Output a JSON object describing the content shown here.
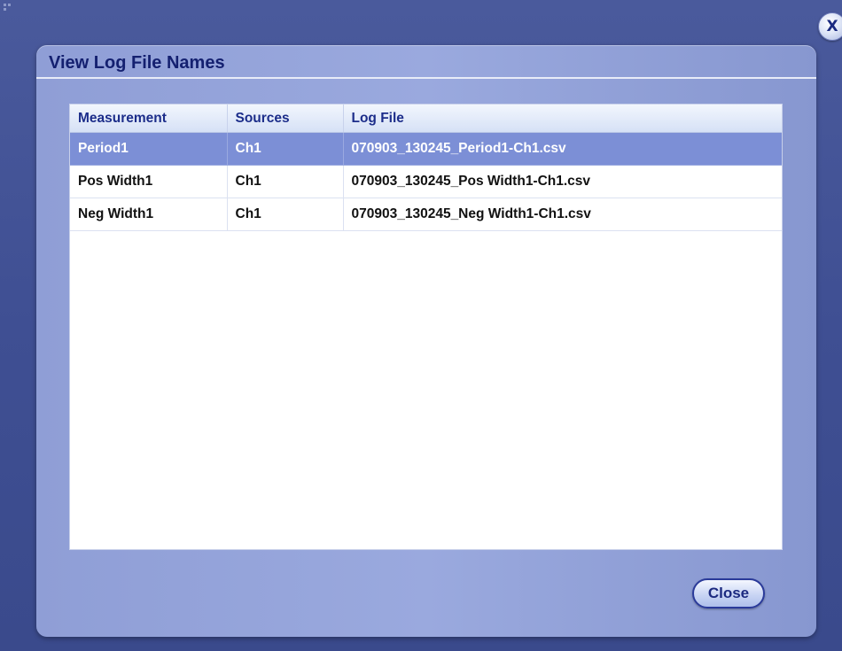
{
  "window": {
    "close_glyph": "X"
  },
  "dialog": {
    "title": "View Log File Names",
    "close_button_label": "Close"
  },
  "table": {
    "headers": [
      "Measurement",
      "Sources",
      "Log File"
    ],
    "rows": [
      [
        "Period1",
        "Ch1",
        "070903_130245_Period1-Ch1.csv"
      ],
      [
        "Pos Width1",
        "Ch1",
        "070903_130245_Pos Width1-Ch1.csv"
      ],
      [
        "Neg Width1",
        "Ch1",
        "070903_130245_Neg Width1-Ch1.csv"
      ]
    ],
    "selected_row": 0
  },
  "colors": {
    "background": "#4a5a9c",
    "dialog": "#9aa9de",
    "title": "#142070",
    "header_text": "#1c2d8a",
    "selected_row": "#7c8fd6"
  }
}
